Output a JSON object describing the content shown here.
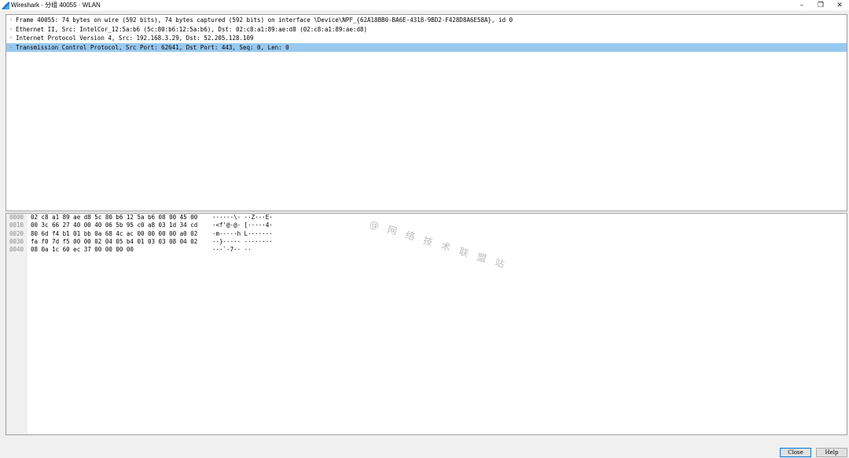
{
  "window": {
    "title": "Wireshark · 分组 40055 · WLAN",
    "controls": {
      "minimize": "–",
      "restore": "❐",
      "close": "✕"
    }
  },
  "tree": {
    "rows": [
      {
        "text": "Frame 40055: 74 bytes on wire (592 bits), 74 bytes captured (592 bits) on interface \\Device\\NPF_{62A18BB0-BA6E-4318-9BD2-F428D8A6E58A}, id 0",
        "selected": false
      },
      {
        "text": "Ethernet II, Src: IntelCor_12:5a:b6 (5c:80:b6:12:5a:b6), Dst: 02:c8:a1:89:ae:d8 (02:c8:a1:89:ae:d8)",
        "selected": false
      },
      {
        "text": "Internet Protocol Version 4, Src: 192.168.3.29, Dst: 52.205.128.109",
        "selected": false
      },
      {
        "text": "Transmission Control Protocol, Src Port: 62641, Dst Port: 443, Seq: 0, Len: 0",
        "selected": true
      }
    ],
    "expander_glyph": "›"
  },
  "bytes": {
    "rows": [
      {
        "offset": "0000",
        "hex": "02 c8 a1 89 ae d8 5c 80  b6 12 5a b6 08 00 45 00",
        "ascii": "······\\·  ··Z···E·"
      },
      {
        "offset": "0010",
        "hex": "00 3c 66 27 40 00 40 06  5b 95 c0 a8 03 1d 34 cd",
        "ascii": "·<f'@·@·  [·····4·"
      },
      {
        "offset": "0020",
        "hex": "80 6d f4 b1 01 bb 0a 68  4c ac 00 00 00 00 a0 02",
        "ascii": "·m·····h  L·······"
      },
      {
        "offset": "0030",
        "hex": "fa f0 7d f5 00 00 02 04  05 b4 01 03 03 08 04 02",
        "ascii": "··}·····  ········"
      },
      {
        "offset": "0040",
        "hex": "08 0a 1c 60 ec 37 00 00  00 00",
        "ascii": "···`·7··  ··"
      }
    ]
  },
  "watermark": "@ 网 络 技 术 联 盟 站",
  "buttons": {
    "close": "Close",
    "help": "Help"
  },
  "colors": {
    "selection": "#99c9ef",
    "accent": "#0078d7"
  }
}
